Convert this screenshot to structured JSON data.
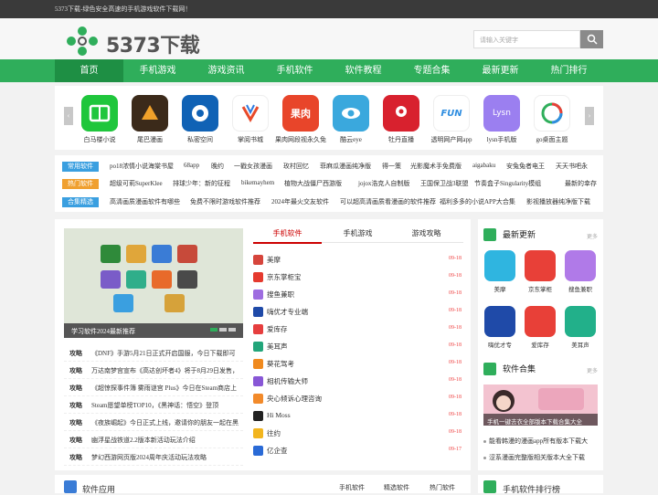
{
  "topbar": {
    "text": "5373下载-绿色安全高速的手机游戏软件下载网！"
  },
  "header": {
    "logo_text": "5373下载",
    "search_placeholder": "请输入关键字"
  },
  "nav": [
    "首页",
    "手机游戏",
    "游戏资讯",
    "手机软件",
    "软件教程",
    "专题合集",
    "最新更新",
    "热门排行"
  ],
  "apps": [
    {
      "name": "白马楼小说",
      "color": "#1fc63c",
      "glyph": "📖"
    },
    {
      "name": "尾巴漫画",
      "color": "#3b2a1a",
      "glyph": "🦊"
    },
    {
      "name": "私密空间",
      "color": "#1062b5",
      "glyph": "✱"
    },
    {
      "name": "掌阅书城",
      "color": "#ffffff",
      "glyph": "📘"
    },
    {
      "name": "果肉网段视永久免",
      "color": "#e8452a",
      "glyph": "果肉"
    },
    {
      "name": "酷云eye",
      "color": "#3aa8dd",
      "glyph": "👁"
    },
    {
      "name": "牡丹直播",
      "color": "#d8212e",
      "glyph": "✿"
    },
    {
      "name": "透明网产网app",
      "color": "#ffffff",
      "glyph": "FUN"
    },
    {
      "name": "lysn手机版",
      "color": "#9b7ff0",
      "glyph": "Lysn"
    },
    {
      "name": "go桌面主题",
      "color": "#ffffff",
      "glyph": "GO"
    }
  ],
  "tags": [
    {
      "label": "常用软件",
      "color": "#3a9fe0",
      "items": [
        "po18浓情小说海棠书屋",
        "68app",
        "晚约",
        "一戳女孩漫画",
        "玫村回忆",
        "菲麻瓜漫画纯净版",
        "得一策",
        "光影魔术手免费版",
        "aigabaku",
        "安兔兔者电王",
        "天天书吧永"
      ]
    },
    {
      "label": "热门软件",
      "color": "#f0a030",
      "items": [
        "超级可莉SuperKlee",
        "排球少年：新的征程",
        "bikemayhem",
        "植物大战僵尸西游版",
        "jojox浩克人自制版",
        "王国保卫战3联盟",
        "节奏盒子Singularity模组",
        "最新的幸存"
      ]
    },
    {
      "label": "合集精选",
      "color": "#3a9fe0",
      "items": [
        "高清画质漫画软件有哪些",
        "免费不限时游戏软件推荐",
        "2024年最火交友软件",
        "可以超高清画质看漫画的软件推荐",
        "福利多多的小说APP大合集",
        "影视播放器纯净版下载"
      ]
    }
  ],
  "slider": {
    "caption": "学习软件2024最新推荐"
  },
  "strategies": [
    {
      "label": "攻略",
      "text": "《DNF》手游5月21日正式开启国服，今日下载即可"
    },
    {
      "label": "攻略",
      "text": "万达南梦宫宣布《高达创坏者4》将于8月29日发售，"
    },
    {
      "label": "攻略",
      "text": "《超惊探事件簿 雾雨谜宫 Plus》今日在Steam商店上"
    },
    {
      "label": "攻略",
      "text": "Steam愿望单榜TOP10，《黑神话：悟空》登顶"
    },
    {
      "label": "攻略",
      "text": "《夜族崛起》今日正式上线，邀请你的朋友一起在黑"
    },
    {
      "label": "攻略",
      "text": "幽浮星战铁道2.2版本新活动玩法介绍"
    },
    {
      "label": "攻略",
      "text": "梦幻西游网页版2024周年庆活动玩法攻略"
    }
  ],
  "tabs": [
    "手机软件",
    "手机游戏",
    "游戏攻略"
  ],
  "list": [
    {
      "name": "美摩",
      "date": "09-18",
      "color": "#d6453c"
    },
    {
      "name": "京东掌柜宝",
      "date": "09-18",
      "color": "#e53a2e"
    },
    {
      "name": "搜鱼兼职",
      "date": "09-18",
      "color": "#9e6de0"
    },
    {
      "name": "嗨优才专业端",
      "date": "09-18",
      "color": "#1f4aa8"
    },
    {
      "name": "爱库存",
      "date": "09-18",
      "color": "#e63e3e"
    },
    {
      "name": "美耳声",
      "date": "09-18",
      "color": "#22a57a"
    },
    {
      "name": "葵花驾考",
      "date": "09-18",
      "color": "#f08a1e"
    },
    {
      "name": "相机传输大师",
      "date": "09-18",
      "color": "#8857d6"
    },
    {
      "name": "央心倾诉心理咨询",
      "date": "09-18",
      "color": "#f28a2a"
    },
    {
      "name": "Hi Moss",
      "date": "09-18",
      "color": "#222222"
    },
    {
      "name": "往约",
      "date": "09-18",
      "color": "#f2b51e"
    },
    {
      "name": "亿企查",
      "date": "09-17",
      "color": "#2a6ad6"
    }
  ],
  "right": {
    "latest_title": "最新更新",
    "more": "更多",
    "grid": [
      {
        "name": "美摩",
        "color": "#2fb5e0"
      },
      {
        "name": "京东掌柜",
        "color": "#e84038"
      },
      {
        "name": "搜鱼兼职",
        "color": "#b07ae8"
      },
      {
        "name": "嗨优才专",
        "color": "#1f4aa8"
      },
      {
        "name": "爱库存",
        "color": "#e84038"
      },
      {
        "name": "美耳声",
        "color": "#22b08a"
      }
    ],
    "collection_title": "软件合集",
    "banner_caption": "手机一键去衣全部版本下载合集大全",
    "links": [
      "能看韩漫的漫画app所有版本下载大",
      "涩系漫画完整版相关版本大全下载"
    ]
  },
  "bottom": {
    "title": "软件应用",
    "tabs": [
      "手机软件",
      "精选软件",
      "热门软件"
    ],
    "right_title": "手机软件排行榜"
  }
}
